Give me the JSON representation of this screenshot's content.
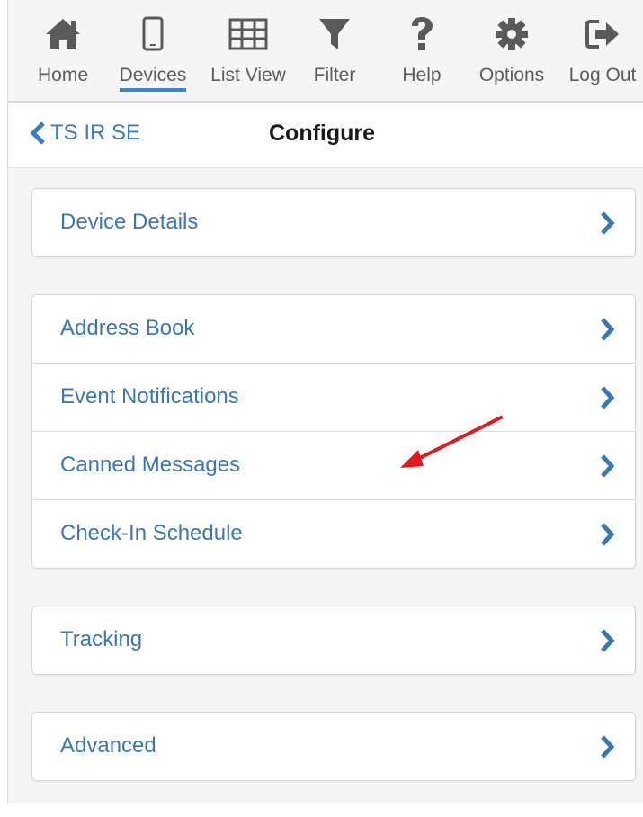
{
  "toolbar": {
    "items": [
      {
        "label": "Home",
        "icon": "home-icon"
      },
      {
        "label": "Devices",
        "icon": "phone-icon",
        "active": true
      },
      {
        "label": "List View",
        "icon": "grid-icon"
      },
      {
        "label": "Filter",
        "icon": "filter-icon"
      },
      {
        "label": "Help",
        "icon": "question-icon"
      },
      {
        "label": "Options",
        "icon": "gear-icon"
      },
      {
        "label": "Log Out",
        "icon": "logout-icon"
      }
    ]
  },
  "header": {
    "back_label": "TS IR SE",
    "title": "Configure"
  },
  "groups": [
    {
      "rows": [
        {
          "label": "Device Details"
        }
      ]
    },
    {
      "rows": [
        {
          "label": "Address Book"
        },
        {
          "label": "Event Notifications"
        },
        {
          "label": "Canned Messages"
        },
        {
          "label": "Check-In Schedule"
        }
      ]
    },
    {
      "rows": [
        {
          "label": "Tracking"
        }
      ]
    },
    {
      "rows": [
        {
          "label": "Advanced"
        }
      ]
    }
  ],
  "colors": {
    "accent": "#3a86c8",
    "link_text": "#3a78b5",
    "icon": "#5a5a5a",
    "annotation_arrow": "#e0191f"
  }
}
